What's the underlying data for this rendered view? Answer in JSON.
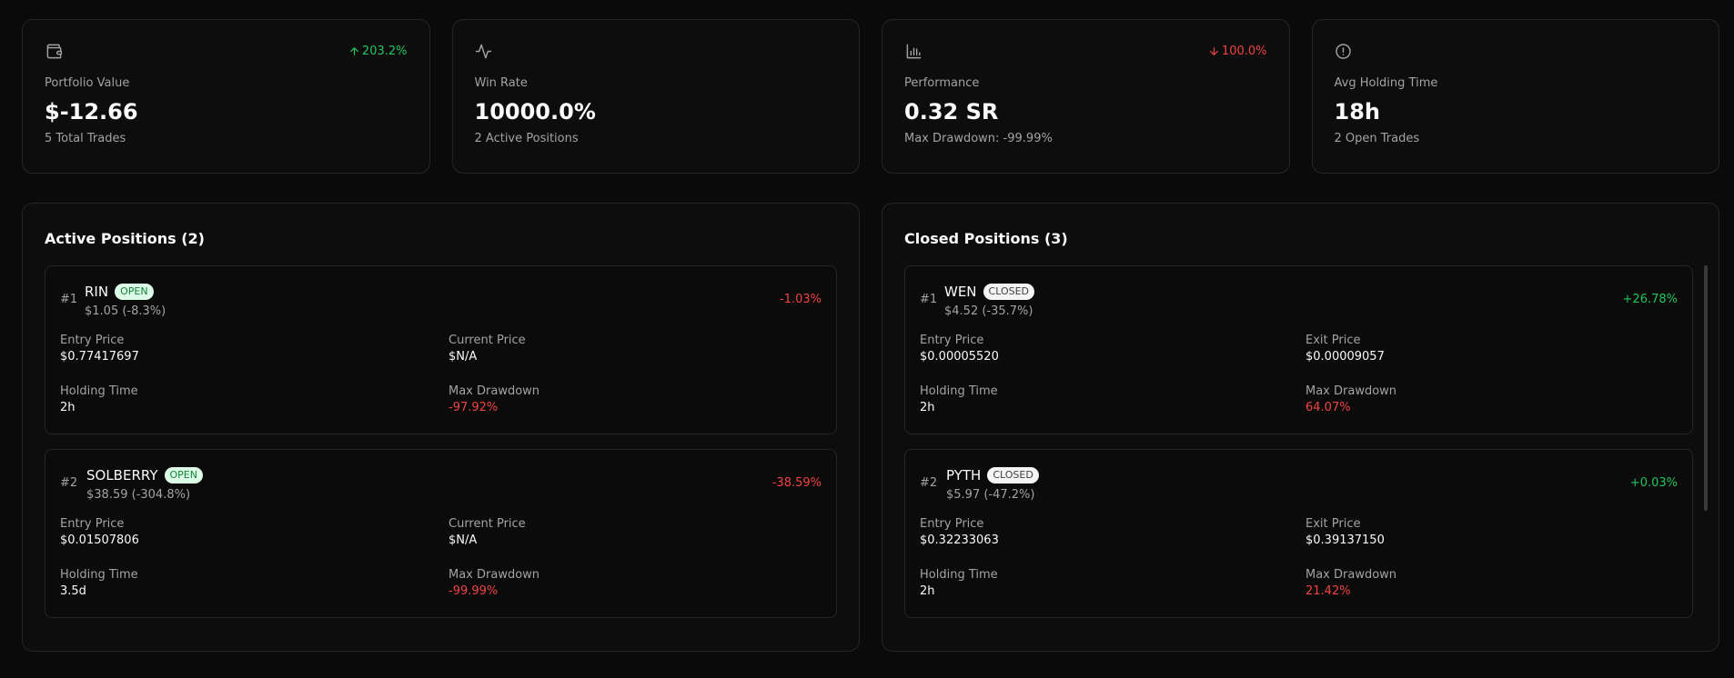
{
  "stats": [
    {
      "icon": "wallet-icon",
      "change": "203.2%",
      "change_dir": "up",
      "label": "Portfolio Value",
      "value": "$-12.66",
      "sub": "5 Total Trades"
    },
    {
      "icon": "activity-icon",
      "change": "",
      "change_dir": "",
      "label": "Win Rate",
      "value": "10000.0%",
      "sub": "2 Active Positions"
    },
    {
      "icon": "bar-chart-icon",
      "change": "100.0%",
      "change_dir": "down",
      "label": "Performance",
      "value": "0.32 SR",
      "sub": "Max Drawdown: -99.99%"
    },
    {
      "icon": "alert-circle-icon",
      "change": "",
      "change_dir": "",
      "label": "Avg Holding Time",
      "value": "18h",
      "sub": "2 Open Trades"
    }
  ],
  "active": {
    "title": "Active Positions (2)",
    "positions": [
      {
        "num": "#1",
        "name": "RIN",
        "badge": "OPEN",
        "sub": "$1.05 (-8.3%)",
        "pnl": "-1.03%",
        "entry_label": "Entry Price",
        "entry": "$0.77417697",
        "price_label": "Current Price",
        "price": "$N/A",
        "hold_label": "Holding Time",
        "hold": "2h",
        "dd_label": "Max Drawdown",
        "dd": "-97.92%"
      },
      {
        "num": "#2",
        "name": "SOLBERRY",
        "badge": "OPEN",
        "sub": "$38.59 (-304.8%)",
        "pnl": "-38.59%",
        "entry_label": "Entry Price",
        "entry": "$0.01507806",
        "price_label": "Current Price",
        "price": "$N/A",
        "hold_label": "Holding Time",
        "hold": "3.5d",
        "dd_label": "Max Drawdown",
        "dd": "-99.99%"
      }
    ]
  },
  "closed": {
    "title": "Closed Positions (3)",
    "positions": [
      {
        "num": "#1",
        "name": "WEN",
        "badge": "CLOSED",
        "sub": "$4.52 (-35.7%)",
        "pnl": "+26.78%",
        "entry_label": "Entry Price",
        "entry": "$0.00005520",
        "price_label": "Exit Price",
        "price": "$0.00009057",
        "hold_label": "Holding Time",
        "hold": "2h",
        "dd_label": "Max Drawdown",
        "dd": "64.07%"
      },
      {
        "num": "#2",
        "name": "PYTH",
        "badge": "CLOSED",
        "sub": "$5.97 (-47.2%)",
        "pnl": "+0.03%",
        "entry_label": "Entry Price",
        "entry": "$0.32233063",
        "price_label": "Exit Price",
        "price": "$0.39137150",
        "hold_label": "Holding Time",
        "hold": "2h",
        "dd_label": "Max Drawdown",
        "dd": "21.42%"
      }
    ]
  },
  "colors": {
    "positive": "#22c55e",
    "negative": "#ef4444",
    "background": "#0a0a0a",
    "border": "#262626"
  }
}
